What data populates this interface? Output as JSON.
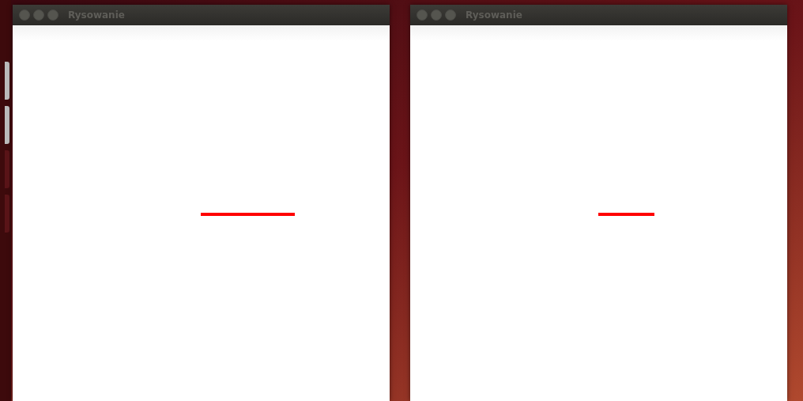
{
  "windows": [
    {
      "title": "Rysowanie",
      "focused": false
    },
    {
      "title": "Rysowanie",
      "focused": false
    }
  ]
}
